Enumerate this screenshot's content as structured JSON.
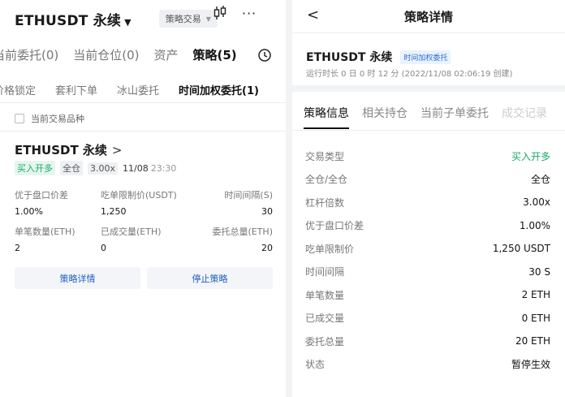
{
  "left": {
    "symbol": "ETHUSDT 永续",
    "strategy_pill": "策略交易",
    "tabs_top": [
      {
        "label": "当前委托(0)"
      },
      {
        "label": "当前仓位(0)"
      },
      {
        "label": "资产"
      },
      {
        "label": "策略(5)"
      }
    ],
    "tabs_sub": [
      {
        "label": "价格锁定"
      },
      {
        "label": "套利下单"
      },
      {
        "label": "冰山委托"
      },
      {
        "label": "时间加权委托(1)"
      }
    ],
    "filter_label": "当前交易品种",
    "card": {
      "title": "ETHUSDT 永续",
      "tag_side": "买入开多",
      "tag_margin": "全仓",
      "tag_leverage": "3.00x",
      "date": "11/08",
      "time": "23:30",
      "row1_labels": [
        "优于盘口价差",
        "吃单限制价(USDT)",
        "时间间隔(S)"
      ],
      "row1_values": [
        "1.00%",
        "1,250",
        "30"
      ],
      "row2_labels": [
        "单笔数量(ETH)",
        "已成交量(ETH)",
        "委托总量(ETH)"
      ],
      "row2_values": [
        "2",
        "0",
        "20"
      ],
      "btn_details": "策略详情",
      "btn_stop": "停止策略"
    }
  },
  "right": {
    "title": "策略详情",
    "symbol": "ETHUSDT 永续",
    "badge": "时间加权委托",
    "runtime": "运行时长 0 日 0 时 12 分 (2022/11/08 02:06:19 创建)",
    "tabs": [
      {
        "label": "策略信息"
      },
      {
        "label": "相关持仓"
      },
      {
        "label": "当前子单委托"
      },
      {
        "label": "成交记录"
      }
    ],
    "rows": [
      {
        "key": "交易类型",
        "value": "买入开多"
      },
      {
        "key": "全仓/全仓",
        "value": "全仓"
      },
      {
        "key": "杠杆倍数",
        "value": "3.00x"
      },
      {
        "key": "优于盘口价差",
        "value": "1.00%"
      },
      {
        "key": "吃单限制价",
        "value": "1,250 USDT"
      },
      {
        "key": "时间间隔",
        "value": "30 S"
      },
      {
        "key": "单笔数量",
        "value": "2 ETH"
      },
      {
        "key": "已成交量",
        "value": "0 ETH"
      },
      {
        "key": "委托总量",
        "value": "20 ETH"
      },
      {
        "key": "状态",
        "value": "暂停生效"
      }
    ]
  },
  "colors": {
    "accent_blue": "#1f5fbf",
    "buy_green": "#17a86a",
    "badge_blue": "#2a6fd6"
  },
  "icons": [
    "dropdown-caret-icon",
    "candlestick-icon",
    "more-icon",
    "history-clock-icon",
    "chevron-right-icon",
    "back-arrow-icon"
  ]
}
